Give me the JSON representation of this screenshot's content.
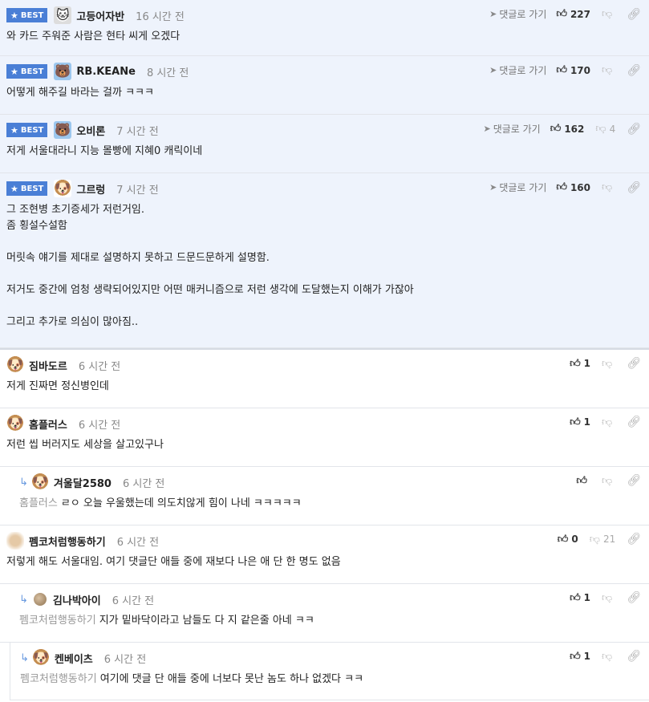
{
  "labels": {
    "best": "BEST",
    "reply_to": "댓글로 가기"
  },
  "best_comments": [
    {
      "nick": "고등어자반",
      "time": "16 시간 전",
      "up": "227",
      "down": "",
      "text": "와 카드 주워준 사람은 현타 씨게 오겠다"
    },
    {
      "nick": "RB.KEANe",
      "time": "8 시간 전",
      "up": "170",
      "down": "",
      "text": "어떻게 해주길 바라는 걸까 ㅋㅋㅋ"
    },
    {
      "nick": "오비론",
      "time": "7 시간 전",
      "up": "162",
      "down": "4",
      "text": "저게 서울대라니 지능 몰빵에 지혜0 캐릭이네"
    },
    {
      "nick": "그르렁",
      "time": "7 시간 전",
      "up": "160",
      "down": "",
      "text": "그 조현병 초기증세가 저런거임.\n좀 횡설수설함\n\n머릿속 얘기를 제대로 설명하지 못하고 드문드문하게 설명함.\n\n저거도 중간에 엄청 생략되어있지만 어떤 매커니즘으로 저런 생각에 도달했는지 이해가 가잖아\n\n그리고 추가로 의심이 많아짐.."
    }
  ],
  "comments": [
    {
      "nick": "짐바도르",
      "time": "6 시간 전",
      "up": "1",
      "down": "",
      "mention": "",
      "text": "저게 진짜면 정신병인데"
    },
    {
      "nick": "홈플러스",
      "time": "6 시간 전",
      "up": "1",
      "down": "",
      "mention": "",
      "text": "저런 씹 버러지도 세상을 살고있구나"
    },
    {
      "nick": "겨울달2580",
      "time": "6 시간 전",
      "up": "",
      "down": "",
      "mention": "홈플러스",
      "text": "ㄹㅇ 오늘 우울했는데 의도치않게 힘이 나네 ㅋㅋㅋㅋㅋ"
    },
    {
      "nick": "펨코처럼행동하기",
      "time": "6 시간 전",
      "up": "0",
      "down": "21",
      "mention": "",
      "text": "저렇게 해도 서울대임. 여기 댓글단 애들 중에 재보다 나은 애 단 한 명도 없음"
    },
    {
      "nick": "김나박아이",
      "time": "6 시간 전",
      "up": "1",
      "down": "",
      "mention": "펨코처럼행동하기",
      "text": "지가 밑바닥이라고 남들도 다 지 같은줄 아네 ㅋㅋ"
    },
    {
      "nick": "켄베이츠",
      "time": "6 시간 전",
      "up": "1",
      "down": "",
      "mention": "펨코처럼행동하기",
      "text": "여기에 댓글 단 애들 중에 너보다 못난 놈도 하나 없겠다 ㅋㅋ"
    }
  ]
}
